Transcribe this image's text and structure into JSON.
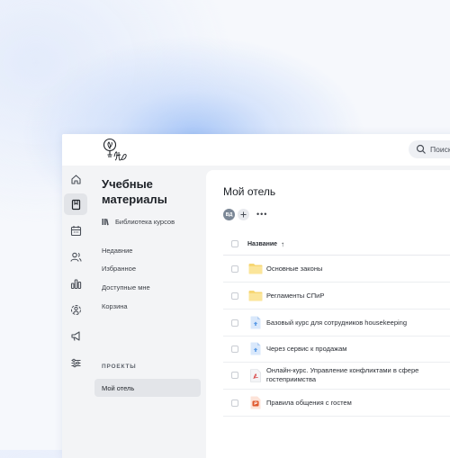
{
  "search": {
    "placeholder": "Поиск..."
  },
  "rail": {
    "items": [
      {
        "icon": "home-icon",
        "active": false
      },
      {
        "icon": "book-icon",
        "active": true
      },
      {
        "icon": "calendar-icon",
        "active": false
      },
      {
        "icon": "users-icon",
        "active": false
      },
      {
        "icon": "bar-chart-icon",
        "active": false
      },
      {
        "icon": "user-target-icon",
        "active": false
      },
      {
        "icon": "megaphone-icon",
        "active": false
      },
      {
        "icon": "sliders-icon",
        "active": false
      }
    ]
  },
  "left_panel": {
    "title": "Учебные материалы",
    "library_label": "Библиотека курсов",
    "nav": [
      {
        "label": "Недавние"
      },
      {
        "label": "Избранное"
      },
      {
        "label": "Доступные мне"
      },
      {
        "label": "Корзина"
      }
    ],
    "projects_label": "ПРОЕКТЫ",
    "projects": [
      {
        "label": "Мой отель",
        "selected": true
      }
    ]
  },
  "content": {
    "title": "Мой отель",
    "avatar_initials": "ВД",
    "more_label": "•••",
    "table": {
      "header": {
        "name_label": "Название",
        "sort": "↑"
      },
      "rows": [
        {
          "type": "folder",
          "icon": "folder-icon",
          "name": "Основные законы"
        },
        {
          "type": "folder",
          "icon": "folder-icon",
          "name": "Регламенты СПиР"
        },
        {
          "type": "course",
          "icon": "course-file-icon",
          "name": "Базовый курс для сотрудников housekeeping"
        },
        {
          "type": "course",
          "icon": "course-file-icon",
          "name": "Через сервис к продажам"
        },
        {
          "type": "document",
          "icon": "pdf-file-icon",
          "name": "Онлайн-курс. Управление конфликтами в сфере гостеприимства"
        },
        {
          "type": "presentation",
          "icon": "ppt-file-icon",
          "name": "Правила общения с гостем"
        }
      ]
    }
  },
  "colors": {
    "accent": "#4a90e2",
    "folder": "#f7d774",
    "course_file": "#5a9be6",
    "pdf_accent": "#d94b4b",
    "ppt_accent": "#e0582d"
  }
}
